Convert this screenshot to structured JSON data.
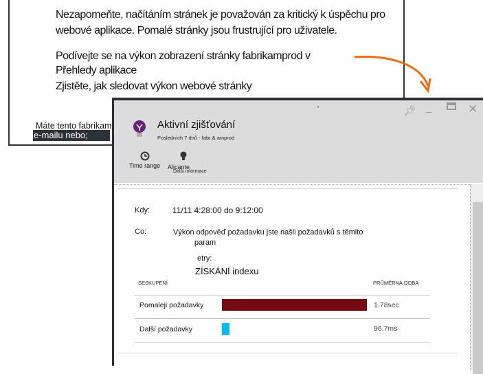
{
  "document": {
    "paragraph1": [
      "Nezapomeňte, načítáním stránek je považován za kritický k úspěchu pro",
      "webové aplikace. Pomalé stránky jsou frustrující pro uživatele."
    ],
    "paragraph2": [
      "Podívejte se na výkon zobrazení stránky fabrikamprod v",
      "Přehledy aplikace",
      "Zjistěte, jak sledovat výkon webové stránky"
    ],
    "owner_text": "Máte tento fabrikamprod",
    "email_text": "e-mailu nebo;"
  },
  "colors": {
    "arrow": "#f26a10",
    "slow_bar": "#750a12",
    "other_bar": "#00bcf2",
    "icon": "#68217a"
  },
  "panel": {
    "title": "Aktivní zjišťování",
    "subtitle": "Posledních 7 dnů - fabr & amprod",
    "toolbar": {
      "time_range": "Time range",
      "alicante": "Alicante",
      "more_info": "Další informace"
    },
    "when_label": "Kdy:",
    "when_value": "11/11 4:28:00 do 9:12:00",
    "what_label": "Co:",
    "what_value_1": "Výkon odpověď požadavku jste našli požadavků s těmito",
    "what_value_2": "param",
    "what_value_3": "etry:",
    "index": "ZÍSKÁNÍ indexu",
    "table": {
      "col_group": "SESKUPENÍ",
      "col_avg": "PRŮMĚRNÁ DOBA",
      "rows": [
        {
          "label": "Pomaleji požadavky",
          "value": "1.78sec",
          "ms": 1780
        },
        {
          "label": "Další požadavky",
          "value": "96.7ms",
          "ms": 96.7
        }
      ]
    }
  }
}
